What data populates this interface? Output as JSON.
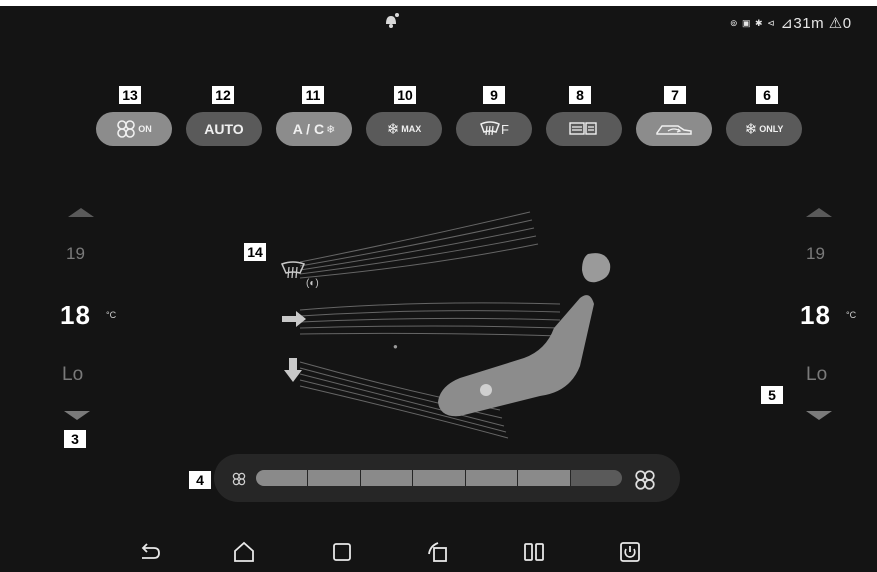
{
  "status_bar": {
    "center_icon": "notification-bell-icon",
    "right_icons_text": "⊚ ▣ ✱ ⊲",
    "signal_icon": "signal-icon",
    "time_text": "31m",
    "alert_icon": "warning-icon",
    "trailing_text": "0"
  },
  "callouts": {
    "c3": "3",
    "c4": "4",
    "c5": "5",
    "c6": "6",
    "c7": "7",
    "c8": "8",
    "c9": "9",
    "c10": "10",
    "c11": "11",
    "c12": "12",
    "c13": "13",
    "c14": "14"
  },
  "controls": {
    "fan_on": {
      "icon": "fan-icon",
      "label": "ON"
    },
    "auto": {
      "label": "AUTO"
    },
    "ac": {
      "label": "A / C",
      "icon": "snowflake-icon"
    },
    "max_ac": {
      "icon": "snowflake-icon",
      "label": "MAX"
    },
    "front_defrost": {
      "icon": "windshield-defrost-icon",
      "label": "F"
    },
    "rear_defrost": {
      "icon": "rear-defrost-icon"
    },
    "recirculation": {
      "icon": "recirculation-car-icon",
      "active": true
    },
    "ac_only": {
      "icon": "snowflake-icon",
      "label": "ONLY"
    }
  },
  "left_temp": {
    "up_icon": "chevron-up-icon",
    "above": "19",
    "current": "18",
    "unit": "°C",
    "below": "Lo",
    "down_icon": "chevron-down-icon"
  },
  "right_temp": {
    "up_icon": "chevron-up-icon",
    "above": "19",
    "current": "18",
    "unit": "°C",
    "below": "Lo",
    "down_icon": "chevron-down-icon"
  },
  "airflow": {
    "windshield_mode_icon": "windshield-defrost-icon",
    "face_mode_icon": "arrow-right-icon",
    "feet_mode_icon": "arrow-down-icon",
    "seat_icon": "seat-icon"
  },
  "fan_speed": {
    "level": 6,
    "max": 7,
    "small_icon": "fan-icon",
    "large_icon": "fan-icon"
  },
  "nav_bar": {
    "icons": [
      "back-icon",
      "home-icon",
      "recents-icon",
      "car-screen-icon",
      "split-screen-icon",
      "power-icon"
    ]
  },
  "colors": {
    "background": "#141414",
    "button_active": "#8c8c8c",
    "button_inactive": "#5a5a5a"
  }
}
